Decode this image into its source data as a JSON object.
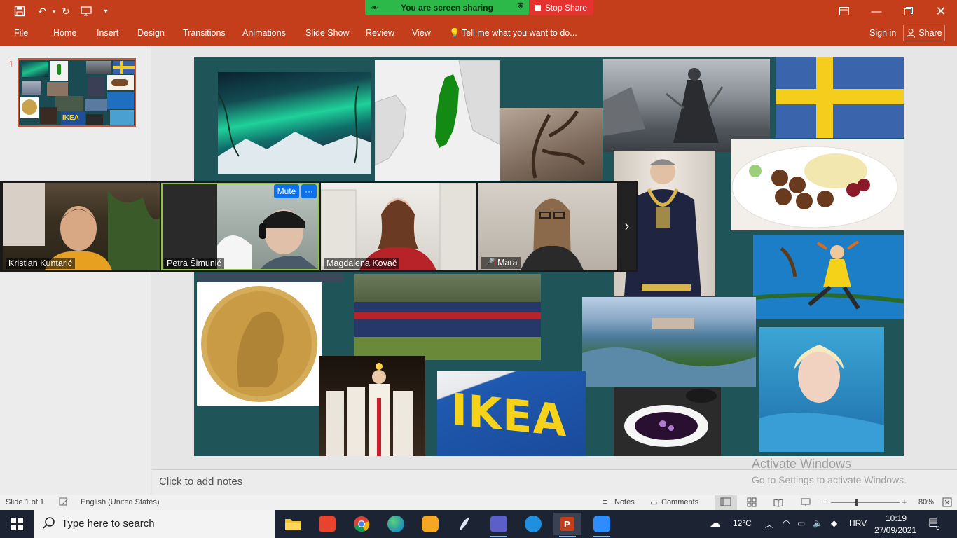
{
  "titlebar": {
    "screen_sharing_label": "You are screen sharing",
    "stop_share_label": "Stop Share"
  },
  "ribbon": {
    "tabs": [
      "File",
      "Home",
      "Insert",
      "Design",
      "Transitions",
      "Animations",
      "Slide Show",
      "Review",
      "View"
    ],
    "tell_me": "Tell me what you want to do...",
    "sign_in": "Sign in",
    "share": "Share"
  },
  "thumbnails": {
    "slide_number": "1"
  },
  "notes": {
    "placeholder": "Click to add notes"
  },
  "watermark": {
    "title": "Activate Windows",
    "subtitle": "Go to Settings to activate Windows."
  },
  "statusbar": {
    "slide_info": "Slide 1 of 1",
    "language": "English (United States)",
    "notes_label": "Notes",
    "comments_label": "Comments",
    "zoom": "80%"
  },
  "video": {
    "participants": [
      {
        "name": "Kristian Kuntarić"
      },
      {
        "name": "Petra Šimunić"
      },
      {
        "name": "Magdalena Kovač"
      },
      {
        "name": "Mara"
      }
    ],
    "mute_label": "Mute",
    "more_label": "···"
  },
  "taskbar": {
    "search_placeholder": "Type here to search",
    "weather": "12°C",
    "language": "HRV",
    "time": "10:19",
    "date": "27/09/2021",
    "notifications": "6"
  },
  "colors": {
    "ribbon": "#c43e1c",
    "slide_bg": "#1f5458",
    "zoom_blue": "#0e71eb",
    "share_green": "#2db84a",
    "stop_red": "#e5312f"
  }
}
